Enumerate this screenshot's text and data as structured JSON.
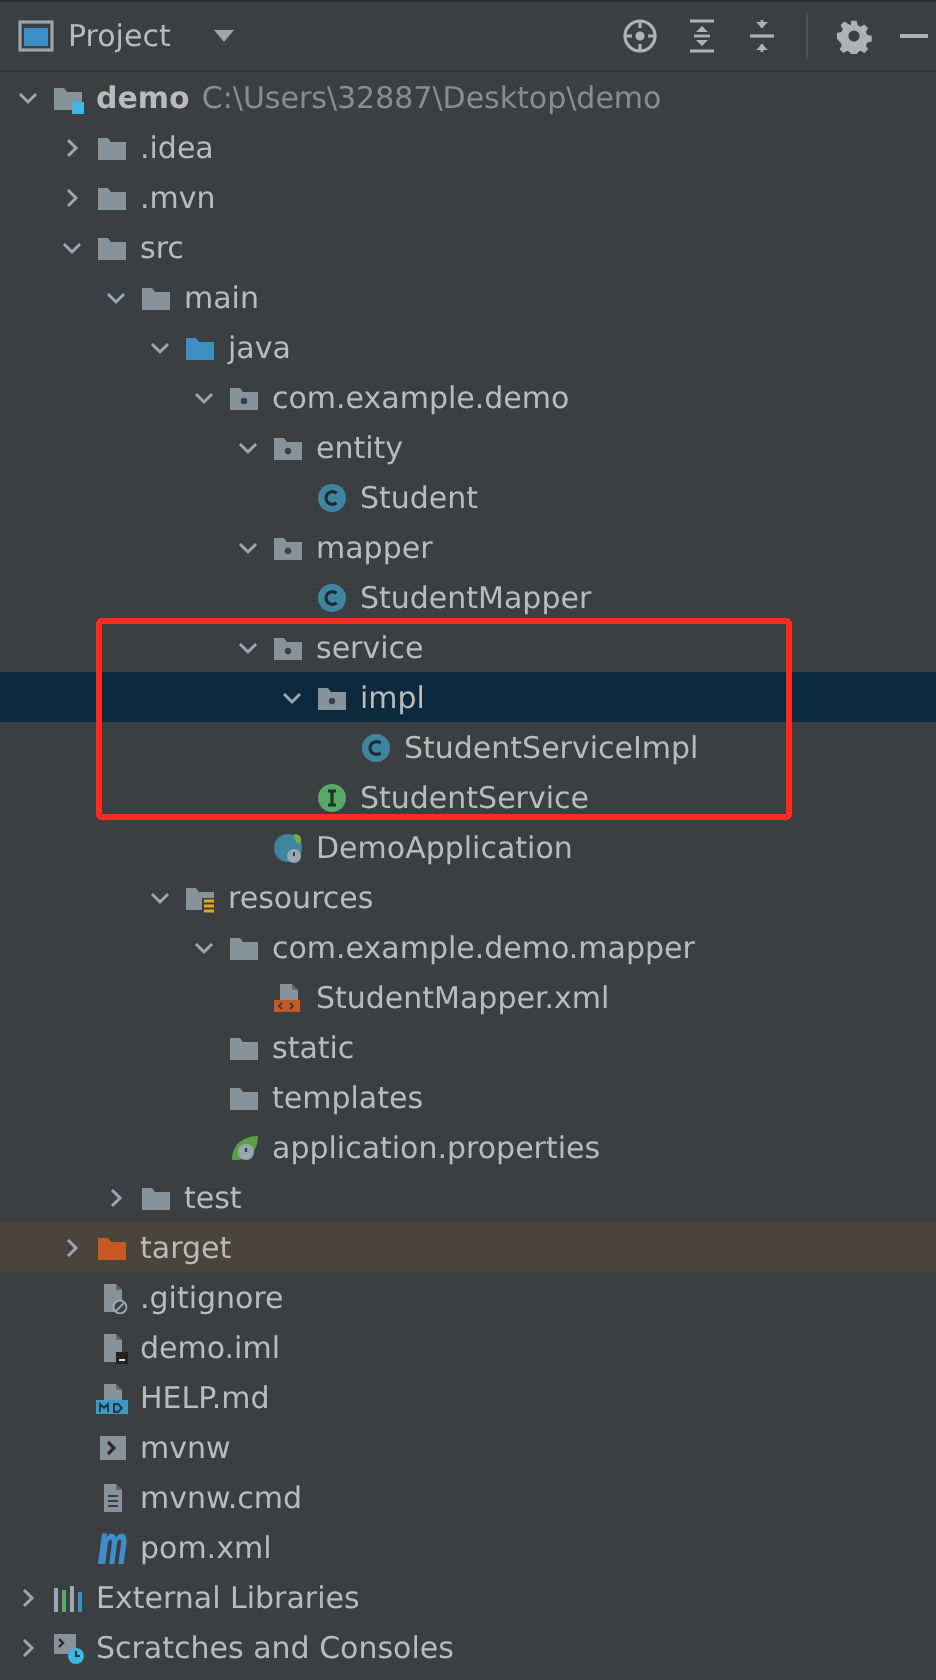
{
  "panel": {
    "title": "Project"
  },
  "highlight": {
    "kind": "frame",
    "color": "#ff2a1e"
  },
  "tree": [
    {
      "label": "demo",
      "path": "C:\\Users\\32887\\Desktop\\demo",
      "kind": "module",
      "expanded": true,
      "selected": false,
      "boxed": false,
      "children": [
        {
          "label": ".idea",
          "kind": "folder",
          "expanded": false,
          "selected": false,
          "boxed": false
        },
        {
          "label": ".mvn",
          "kind": "folder",
          "expanded": false,
          "selected": false,
          "boxed": false
        },
        {
          "label": "src",
          "kind": "folder",
          "expanded": true,
          "selected": false,
          "boxed": false,
          "children": [
            {
              "label": "main",
              "kind": "folder",
              "expanded": true,
              "selected": false,
              "boxed": false,
              "children": [
                {
                  "label": "java",
                  "kind": "source-folder",
                  "expanded": true,
                  "selected": false,
                  "boxed": false,
                  "children": [
                    {
                      "label": "com.example.demo",
                      "kind": "package",
                      "expanded": true,
                      "selected": false,
                      "boxed": false,
                      "children": [
                        {
                          "label": "entity",
                          "kind": "package",
                          "expanded": true,
                          "selected": false,
                          "boxed": false,
                          "children": [
                            {
                              "label": "Student",
                              "kind": "class",
                              "selected": false,
                              "boxed": false
                            }
                          ]
                        },
                        {
                          "label": "mapper",
                          "kind": "package",
                          "expanded": true,
                          "selected": false,
                          "boxed": false,
                          "children": [
                            {
                              "label": "StudentMapper",
                              "kind": "class",
                              "selected": false,
                              "boxed": false
                            }
                          ]
                        },
                        {
                          "label": "service",
                          "kind": "package",
                          "expanded": true,
                          "selected": false,
                          "boxed": true,
                          "children": [
                            {
                              "label": "impl",
                              "kind": "package",
                              "expanded": true,
                              "selected": true,
                              "boxed": true,
                              "children": [
                                {
                                  "label": "StudentServiceImpl",
                                  "kind": "class",
                                  "selected": false,
                                  "boxed": true
                                }
                              ]
                            },
                            {
                              "label": "StudentService",
                              "kind": "interface",
                              "selected": false,
                              "boxed": true
                            }
                          ]
                        },
                        {
                          "label": "DemoApplication",
                          "kind": "spring-class",
                          "selected": false,
                          "boxed": false
                        }
                      ]
                    }
                  ]
                },
                {
                  "label": "resources",
                  "kind": "resources-folder",
                  "expanded": true,
                  "selected": false,
                  "boxed": false,
                  "children": [
                    {
                      "label": "com.example.demo.mapper",
                      "kind": "folder",
                      "expanded": true,
                      "selected": false,
                      "boxed": false,
                      "children": [
                        {
                          "label": "StudentMapper.xml",
                          "kind": "xml",
                          "selected": false,
                          "boxed": false
                        }
                      ]
                    },
                    {
                      "label": "static",
                      "kind": "folder",
                      "selected": false,
                      "boxed": false
                    },
                    {
                      "label": "templates",
                      "kind": "folder",
                      "selected": false,
                      "boxed": false
                    },
                    {
                      "label": "application.properties",
                      "kind": "spring-properties",
                      "selected": false,
                      "boxed": false
                    }
                  ]
                }
              ]
            },
            {
              "label": "test",
              "kind": "folder",
              "expanded": false,
              "selected": false,
              "boxed": false
            }
          ]
        },
        {
          "label": "target",
          "kind": "excluded-folder",
          "expanded": false,
          "selected": false,
          "boxed": false
        },
        {
          "label": ".gitignore",
          "kind": "ignore-file",
          "selected": false,
          "boxed": false
        },
        {
          "label": "demo.iml",
          "kind": "module-file",
          "selected": false,
          "boxed": false
        },
        {
          "label": "HELP.md",
          "kind": "markdown",
          "selected": false,
          "boxed": false
        },
        {
          "label": "mvnw",
          "kind": "shell",
          "selected": false,
          "boxed": false
        },
        {
          "label": "mvnw.cmd",
          "kind": "text",
          "selected": false,
          "boxed": false
        },
        {
          "label": "pom.xml",
          "kind": "maven",
          "selected": false,
          "boxed": false
        }
      ]
    },
    {
      "label": "External Libraries",
      "kind": "libraries",
      "expanded": false,
      "selected": false,
      "boxed": false
    },
    {
      "label": "Scratches and Consoles",
      "kind": "scratches",
      "expanded": false,
      "selected": false,
      "boxed": false
    }
  ]
}
